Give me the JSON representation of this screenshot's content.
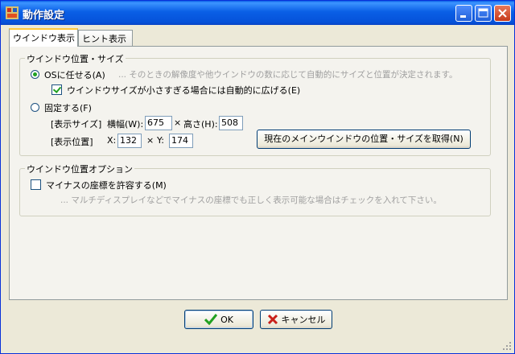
{
  "window": {
    "title": "動作設定"
  },
  "tabs": [
    {
      "label": "ウインドウ表示"
    },
    {
      "label": "ヒント表示"
    }
  ],
  "group_position": {
    "title": "ウインドウ位置・サイズ",
    "os_radio_label": "OSに任せる(A)",
    "os_desc": "... そのときの解像度や他ウインドウの数に応じて自動的にサイズと位置が決定されます。",
    "expand_check_label": "ウインドウサイズが小さすぎる場合には自動的に広げる(E)",
    "fixed_radio_label": "固定する(F)",
    "size_label": "[表示サイズ]",
    "width_label": "横幅(W):",
    "width_value": "675",
    "times1": "×",
    "height_label": "高さ(H):",
    "height_value": "508",
    "pos_label": "[表示位置]",
    "x_label": "X:",
    "x_value": "132",
    "times2": "×",
    "y_label": "Y:",
    "y_value": "174",
    "get_button_label": "現在のメインウインドウの位置・サイズを取得(N)"
  },
  "group_option": {
    "title": "ウインドウ位置オプション",
    "minus_check_label": "マイナスの座標を許容する(M)",
    "minus_desc": "... マルチディスプレイなどでマイナスの座標でも正しく表示可能な場合はチェックを入れて下さい。"
  },
  "buttons": {
    "ok_label": "OK",
    "cancel_label": "キャンセル"
  },
  "colors": {
    "title_bar": "#0a5fe6",
    "check_green": "#21a121",
    "cancel_red": "#c8201a"
  }
}
